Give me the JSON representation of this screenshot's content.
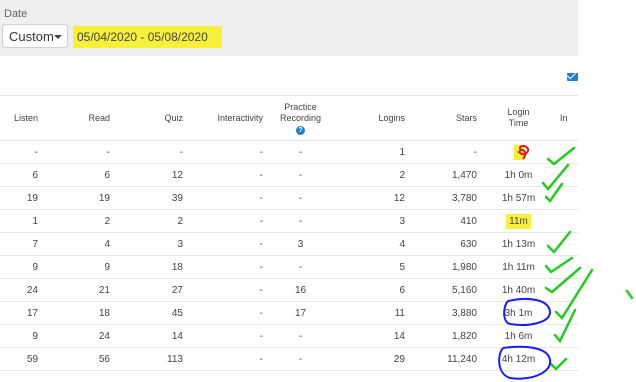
{
  "filter": {
    "date_label": "Date",
    "range_type": "Custom",
    "date_range": "05/04/2020 - 05/08/2020"
  },
  "icons": {
    "mail": "mail-icon",
    "help": "help-circle-icon",
    "help_glyph": "?"
  },
  "table": {
    "headers": {
      "listen": "Listen",
      "read": "Read",
      "quiz": "Quiz",
      "interactivity": "Interactivity",
      "practice_line1": "Practice",
      "practice_line2": "Recording",
      "logins": "Logins",
      "stars": "Stars",
      "login_time_line1": "Login",
      "login_time_line2": "Time",
      "ind": "In"
    },
    "rows": [
      {
        "listen": "-",
        "read": "-",
        "quiz": "-",
        "interactivity": "-",
        "practice": "-",
        "logins": "1",
        "stars": "-",
        "login_time": "-"
      },
      {
        "listen": "6",
        "read": "6",
        "quiz": "12",
        "interactivity": "-",
        "practice": "-",
        "logins": "2",
        "stars": "1,470",
        "login_time": "1h 0m"
      },
      {
        "listen": "19",
        "read": "19",
        "quiz": "39",
        "interactivity": "-",
        "practice": "-",
        "logins": "12",
        "stars": "3,780",
        "login_time": "1h 57m"
      },
      {
        "listen": "1",
        "read": "2",
        "quiz": "2",
        "interactivity": "-",
        "practice": "-",
        "logins": "3",
        "stars": "410",
        "login_time": "11m"
      },
      {
        "listen": "7",
        "read": "4",
        "quiz": "3",
        "interactivity": "-",
        "practice": "3",
        "logins": "4",
        "stars": "630",
        "login_time": "1h 13m"
      },
      {
        "listen": "9",
        "read": "9",
        "quiz": "18",
        "interactivity": "-",
        "practice": "-",
        "logins": "5",
        "stars": "1,980",
        "login_time": "1h 11m"
      },
      {
        "listen": "24",
        "read": "21",
        "quiz": "27",
        "interactivity": "-",
        "practice": "16",
        "logins": "6",
        "stars": "5,160",
        "login_time": "1h 40m"
      },
      {
        "listen": "17",
        "read": "18",
        "quiz": "45",
        "interactivity": "-",
        "practice": "17",
        "logins": "11",
        "stars": "3,880",
        "login_time": "3h 1m"
      },
      {
        "listen": "9",
        "read": "24",
        "quiz": "14",
        "interactivity": "-",
        "practice": "-",
        "logins": "14",
        "stars": "1,820",
        "login_time": "1h 6m"
      },
      {
        "listen": "59",
        "read": "56",
        "quiz": "113",
        "interactivity": "-",
        "practice": "-",
        "logins": "29",
        "stars": "11,240",
        "login_time": "4h 12m"
      }
    ]
  },
  "annotation_colors": {
    "highlight": "#f7f03a",
    "check": "#22cc22",
    "circle": "#1a1aff",
    "scribble": "#ee1111"
  }
}
